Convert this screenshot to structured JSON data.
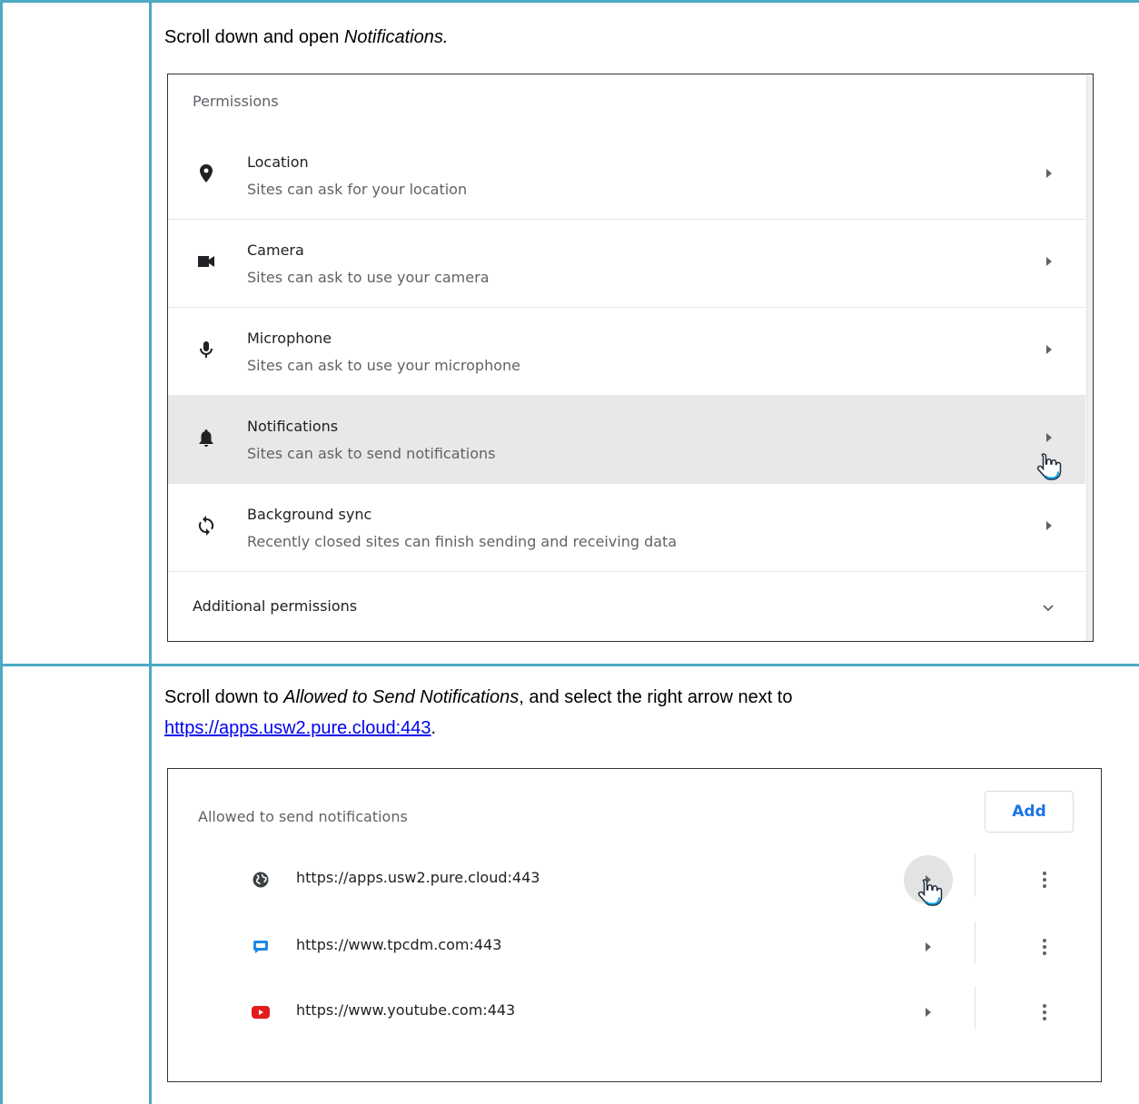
{
  "step1": {
    "instruction_prefix": "Scroll down and open ",
    "instruction_em": "Notifications."
  },
  "permissions": {
    "header": "Permissions",
    "items": [
      {
        "title": "Location",
        "subtitle": "Sites can ask for your location",
        "icon": "location-pin-icon"
      },
      {
        "title": "Camera",
        "subtitle": "Sites can ask to use your camera",
        "icon": "camera-icon"
      },
      {
        "title": "Microphone",
        "subtitle": "Sites can ask to use your microphone",
        "icon": "microphone-icon"
      },
      {
        "title": "Notifications",
        "subtitle": "Sites can ask to send notifications",
        "icon": "bell-icon",
        "selected": true
      },
      {
        "title": "Background sync",
        "subtitle": "Recently closed sites can finish sending and receiving data",
        "icon": "sync-icon"
      }
    ],
    "additional": "Additional permissions"
  },
  "step2": {
    "instruction_prefix": "Scroll down to ",
    "instruction_em": "Allowed to Send Notifications",
    "instruction_mid": ", and select the right arrow next to",
    "link": "https://apps.usw2.pure.cloud:443",
    "instruction_suffix": "."
  },
  "allowed": {
    "header": "Allowed to send notifications",
    "add_label": "Add",
    "sites": [
      {
        "url": "https://apps.usw2.pure.cloud:443",
        "icon": "globe-icon"
      },
      {
        "url": "https://www.tpcdm.com:443",
        "icon": "chat-icon"
      },
      {
        "url": "https://www.youtube.com:443",
        "icon": "youtube-icon"
      }
    ]
  },
  "colors": {
    "table_border": "#4eaac2",
    "link": "#0000ee",
    "accent": "#1a73e8",
    "selected_row": "#e8e8e8"
  }
}
